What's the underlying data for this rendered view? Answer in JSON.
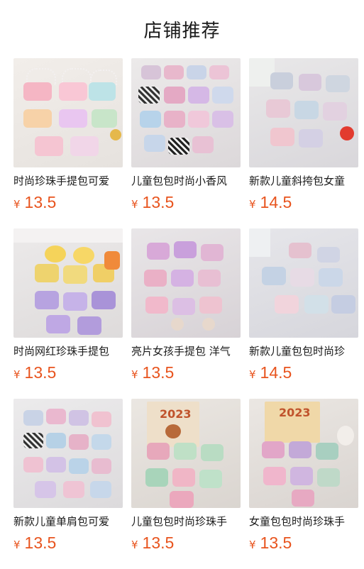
{
  "header": {
    "title": "店铺推荐"
  },
  "products": [
    {
      "name": "时尚珍珠手提包可爱",
      "currency": "¥",
      "price": "13.5",
      "theme": "pink-pastel"
    },
    {
      "name": "儿童包包时尚小香风",
      "currency": "¥",
      "price": "13.5",
      "theme": "plaid"
    },
    {
      "name": "新款儿童斜挎包女童",
      "currency": "¥",
      "price": "14.5",
      "theme": "lace-grey"
    },
    {
      "name": "时尚网红珍珠手提包",
      "currency": "¥",
      "price": "13.5",
      "theme": "cartoon"
    },
    {
      "name": "亮片女孩手提包 洋气",
      "currency": "¥",
      "price": "13.5",
      "theme": "sequin"
    },
    {
      "name": "新款儿童包包时尚珍",
      "currency": "¥",
      "price": "14.5",
      "theme": "lace-blue"
    },
    {
      "name": "新款儿童单肩包可爱",
      "currency": "¥",
      "price": "13.5",
      "theme": "mixed"
    },
    {
      "name": "儿童包包时尚珍珠手",
      "currency": "¥",
      "price": "13.5",
      "theme": "calendar"
    },
    {
      "name": "女童包包时尚珍珠手",
      "currency": "¥",
      "price": "13.5",
      "theme": "calendar-lace"
    }
  ],
  "image_labels": {
    "calendar_year": "2023"
  }
}
